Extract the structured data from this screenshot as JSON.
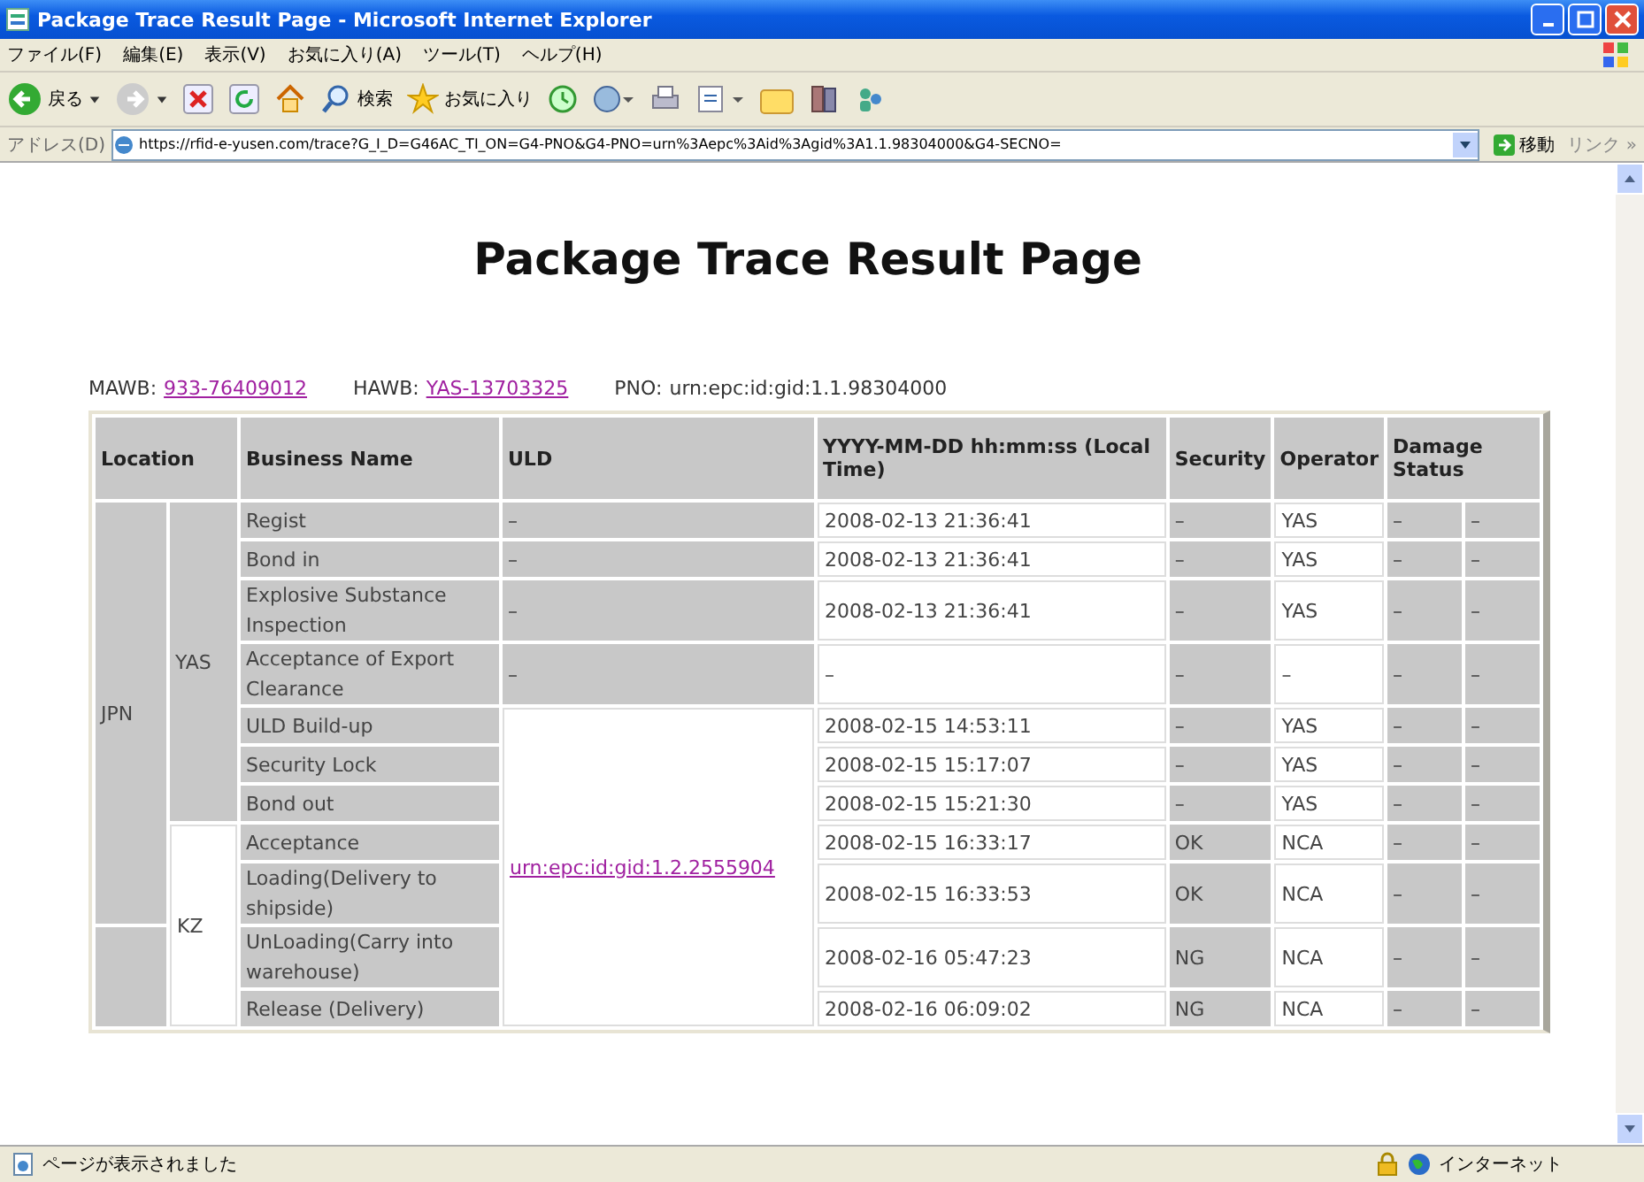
{
  "window": {
    "title": "Package Trace Result Page - Microsoft Internet Explorer"
  },
  "menu": [
    "ファイル(F)",
    "編集(E)",
    "表示(V)",
    "お気に入り(A)",
    "ツール(T)",
    "ヘルプ(H)"
  ],
  "toolbar": {
    "back": "戻る",
    "search": "検索",
    "favorites": "お気に入り"
  },
  "address": {
    "label": "アドレス(D)",
    "url": "https://rfid-e-yusen.com/trace?G_I_D=G46AC_TI_ON=G4-PNO&G4-PNO=urn%3Aepc%3Aid%3Agid%3A1.1.98304000&G4-SECNO=",
    "go": "移動",
    "links": "リンク »"
  },
  "page": {
    "heading": "Package Trace Result Page",
    "info": [
      {
        "label": "MAWB:",
        "link": "933-76409012"
      },
      {
        "label": "HAWB:",
        "link": "YAS-13703325"
      },
      {
        "label": "PNO:",
        "value": "urn:epc:id:gid:1.1.98304000"
      }
    ],
    "columns": [
      {
        "label": "Location",
        "kind": "double"
      },
      {
        "label": "Business Name",
        "kind": "single"
      },
      {
        "label": "ULD",
        "kind": "single"
      },
      {
        "label": "YYYY-MM-DD hh:mm:ss (Local Time)",
        "kind": "single"
      },
      {
        "label": "Security",
        "kind": "single"
      },
      {
        "label": "Operator",
        "kind": "single"
      },
      {
        "label": "Damage Status",
        "kind": "double"
      }
    ],
    "rows": [
      {
        "country": {
          "name": "JPN",
          "shaded": true
        },
        "station": {
          "name": "YAS",
          "shaded": true
        },
        "business": "Regist",
        "uld": {
          "text": "–",
          "shaded": true
        },
        "time": "2008-02-13 21:36:41",
        "security": "–",
        "operator": "YAS",
        "damage": [
          "–",
          "–"
        ]
      },
      {
        "business": "Bond in",
        "uld": {
          "text": "–",
          "shaded": true
        },
        "time": "2008-02-13 21:36:41",
        "security": "–",
        "operator": "YAS",
        "damage": [
          "–",
          "–"
        ]
      },
      {
        "business": "Explosive Substance Inspection",
        "uld": {
          "text": "–",
          "shaded": true
        },
        "time": "2008-02-13 21:36:41",
        "security": "–",
        "operator": "YAS",
        "damage": [
          "–",
          "–"
        ]
      },
      {
        "business": "Acceptance of Export Clearance",
        "uld": {
          "text": "–",
          "shaded": true
        },
        "time": "–",
        "security": "–",
        "operator": "–",
        "damage": [
          "–",
          "–"
        ]
      },
      {
        "business": "ULD Build-up",
        "uld": {
          "link": "urn:epc:id:gid:1.2.2555904",
          "shaded": false
        },
        "time": "2008-02-15 14:53:11",
        "security": "–",
        "operator": "YAS",
        "damage": [
          "–",
          "–"
        ]
      },
      {
        "business": "Security Lock",
        "time": "2008-02-15 15:17:07",
        "security": "–",
        "operator": "YAS",
        "damage": [
          "–",
          "–"
        ]
      },
      {
        "business": "Bond out",
        "time": "2008-02-15 15:21:30",
        "security": "–",
        "operator": "YAS",
        "damage": [
          "–",
          "–"
        ]
      },
      {
        "station": {
          "name": "KZ",
          "shaded": false
        },
        "business": "Acceptance",
        "time": "2008-02-15 16:33:17",
        "security": "OK",
        "operator": "NCA",
        "damage": [
          "–",
          "–"
        ]
      },
      {
        "business": "Loading(Delivery to shipside)",
        "time": "2008-02-15 16:33:53",
        "security": "OK",
        "operator": "NCA",
        "damage": [
          "–",
          "–"
        ]
      },
      {
        "country": {
          "shaded": true
        },
        "business": "UnLoading(Carry into warehouse)",
        "time": "2008-02-16 05:47:23",
        "security": "NG",
        "operator": "NCA",
        "damage": [
          "–",
          "–"
        ]
      },
      {
        "business": "Release (Delivery)",
        "time": "2008-02-16 06:09:02",
        "security": "NG",
        "operator": "NCA",
        "damage": [
          "–",
          "–"
        ]
      }
    ]
  },
  "status_bar": {
    "message": "ページが表示されました",
    "zone": "インターネット"
  }
}
